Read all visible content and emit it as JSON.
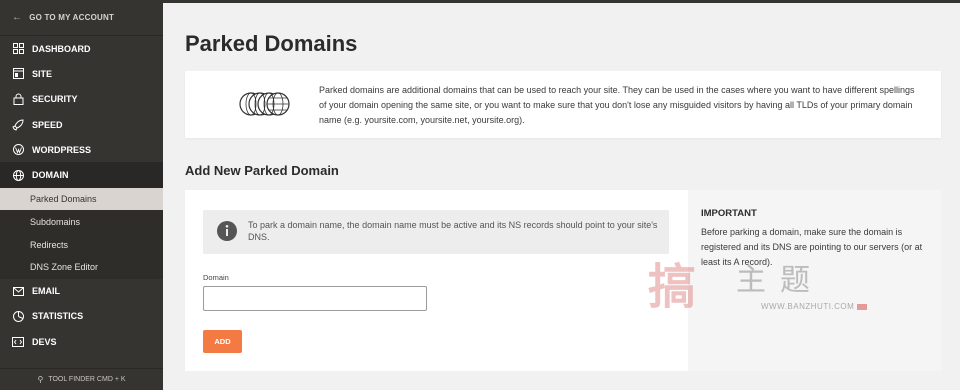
{
  "sidebar": {
    "goto_label": "GO TO MY ACCOUNT",
    "items": [
      {
        "label": "DASHBOARD",
        "icon": "grid-icon"
      },
      {
        "label": "SITE",
        "icon": "window-icon"
      },
      {
        "label": "SECURITY",
        "icon": "lock-icon"
      },
      {
        "label": "SPEED",
        "icon": "rocket-icon"
      },
      {
        "label": "WORDPRESS",
        "icon": "wordpress-icon"
      },
      {
        "label": "DOMAIN",
        "icon": "globe-icon"
      }
    ],
    "sub_items": [
      {
        "label": "Parked Domains"
      },
      {
        "label": "Subdomains"
      },
      {
        "label": "Redirects"
      },
      {
        "label": "DNS Zone Editor"
      }
    ],
    "items_after": [
      {
        "label": "EMAIL",
        "icon": "mail-icon"
      },
      {
        "label": "STATISTICS",
        "icon": "chart-icon"
      },
      {
        "label": "DEVS",
        "icon": "code-icon"
      }
    ],
    "tool_finder": "TOOL FINDER CMD + K"
  },
  "main": {
    "title": "Parked Domains",
    "info_text": "Parked domains are additional domains that can be used to reach your site. They can be used in the cases where you want to have different spellings of your domain opening the same site, or you want to make sure that you don't lose any misguided visitors by having all TLDs of your primary domain name (e.g. yoursite.com, yoursite.net, yoursite.org).",
    "section_title": "Add New Parked Domain",
    "notice_text": "To park a domain name, the domain name must be active and its NS records should point to your site's DNS.",
    "domain_label": "Domain",
    "domain_value": "",
    "domain_placeholder": "",
    "add_label": "ADD",
    "important_title": "IMPORTANT",
    "important_text": "Before parking a domain, make sure the domain is registered and its DNS are pointing to our servers (or at least its A record)."
  },
  "watermark": {
    "cn_text": "主题",
    "url": "WWW.BANZHUTI.COM"
  },
  "colors": {
    "sidebar_bg": "#363431",
    "active_sub_bg": "#d9d4cf",
    "accent": "#f47a43",
    "page_bg": "#f1f1f1"
  }
}
